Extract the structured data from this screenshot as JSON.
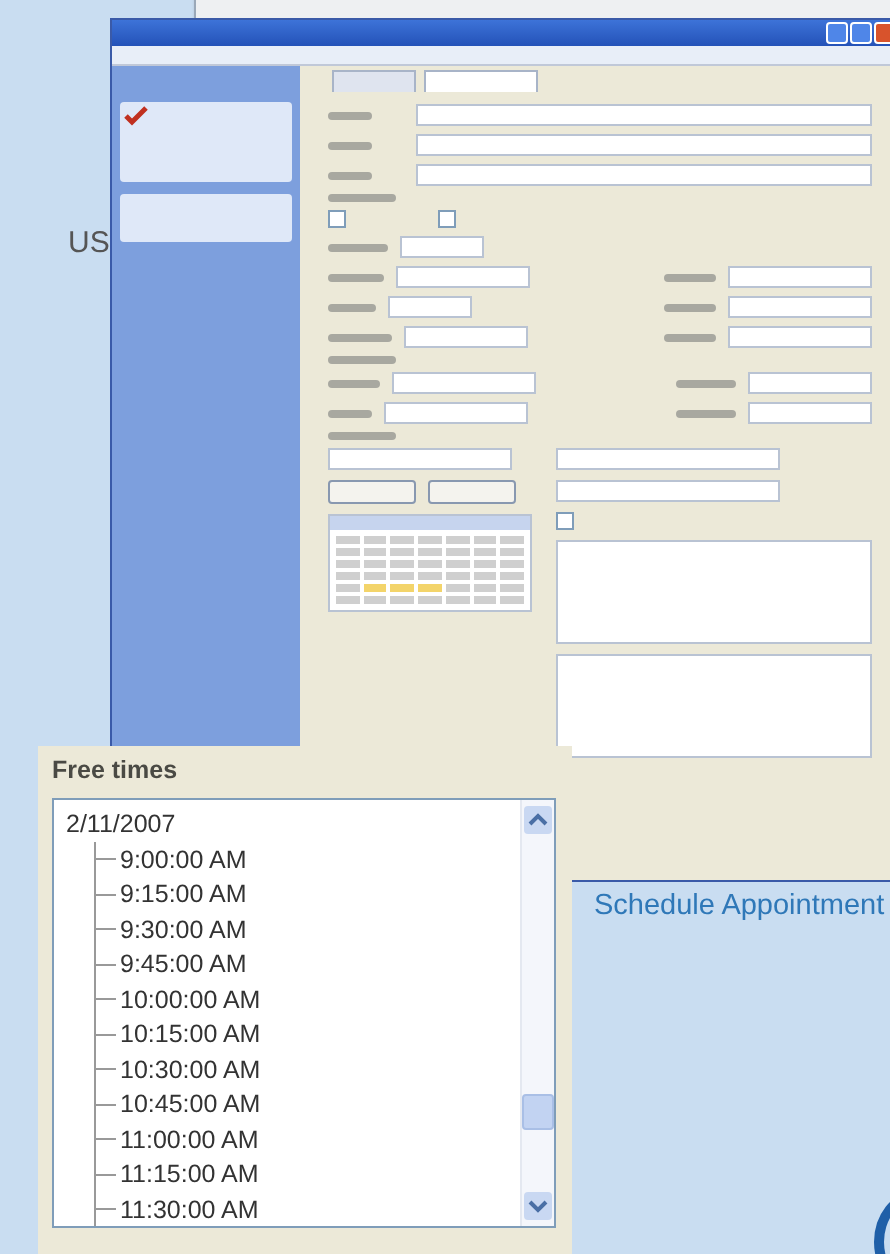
{
  "side_text": "US",
  "form": {
    "checkboxes": [
      {
        "checked": false
      },
      {
        "checked": false
      },
      {
        "checked": false
      }
    ]
  },
  "caption": "Schedule Appointment",
  "inset": {
    "title": "Free times",
    "tree": {
      "label": "2/11/2007",
      "children": [
        {
          "label": "9:00:00 AM"
        },
        {
          "label": "9:15:00 AM"
        },
        {
          "label": "9:30:00 AM"
        },
        {
          "label": "9:45:00 AM"
        },
        {
          "label": "10:00:00 AM"
        },
        {
          "label": "10:15:00 AM"
        },
        {
          "label": "10:30:00 AM"
        },
        {
          "label": "10:45:00 AM"
        },
        {
          "label": "11:00:00 AM"
        },
        {
          "label": "11:15:00 AM"
        },
        {
          "label": "11:30:00 AM"
        }
      ]
    }
  }
}
